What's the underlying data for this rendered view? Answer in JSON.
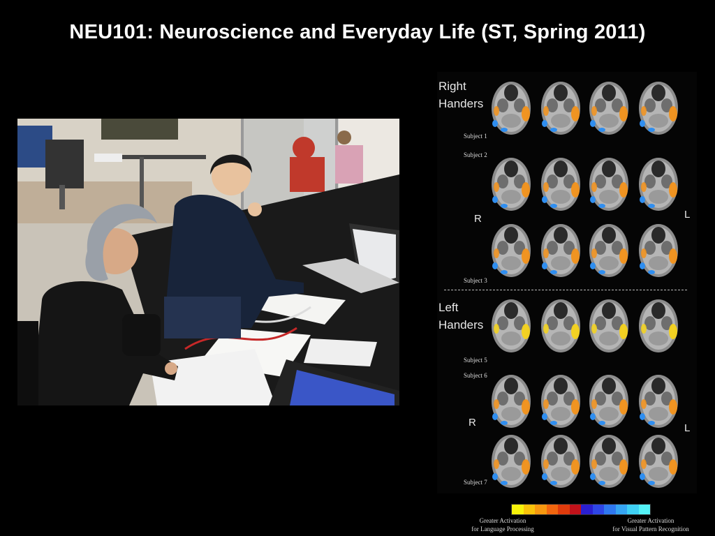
{
  "slide": {
    "title": "NEU101: Neuroscience and Everyday Life (ST, Spring 2011)"
  },
  "figure": {
    "groups": [
      {
        "label_line1": "Right",
        "label_line2": "Handers",
        "subjects": [
          "Subject 1",
          "Subject 2",
          "Subject 3"
        ],
        "left_side": "R",
        "right_side": "L"
      },
      {
        "label_line1": "Left",
        "label_line2": "Handers",
        "subjects": [
          "Subject 5",
          "Subject 6",
          "Subject 7"
        ],
        "left_side": "R",
        "right_side": "L"
      }
    ],
    "legend": {
      "language_line1": "Greater Activation",
      "language_line2": "for Language Processing",
      "visual_line1": "Greater Activation",
      "visual_line2": "for Visual Pattern Recognition",
      "colors": [
        "#f7f20a",
        "#f9c20a",
        "#f79810",
        "#f2660f",
        "#e03b0c",
        "#c1121a",
        "#2a1fd0",
        "#2e46e6",
        "#2f78f0",
        "#36a5f2",
        "#3fd0f4",
        "#54f2f7"
      ]
    }
  }
}
